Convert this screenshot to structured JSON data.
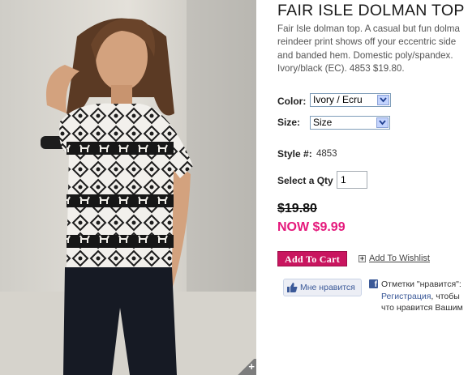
{
  "product": {
    "title": "FAIR ISLE DOLMAN TOP",
    "description": {
      "line1": "Fair Isle dolman top. A casual but fun dolma",
      "line2": "reindeer print shows off your eccentric side",
      "line3": "and banded hem. Domestic poly/spandex.",
      "line4": "Ivory/black (EC). 4853 $19.80."
    },
    "color_label": "Color:",
    "color_value": "Ivory / Ecru",
    "size_label": "Size:",
    "size_value": "Size",
    "style_label": "Style #:",
    "style_value": "4853",
    "qty_label": "Select a Qty",
    "qty_value": "1",
    "old_price": "$19.80",
    "now_price": "NOW $9.99",
    "add_to_cart": "Add To Cart",
    "add_to_wishlist": "Add To Wishlist",
    "wishlist_icon": "+"
  },
  "photo": {
    "zoom_glyph": "+",
    "icon": "zoom-plus-icon"
  },
  "facebook": {
    "like_button": "Мне нравится",
    "logo": "f",
    "text_line1": "Отметки \"нравится\":",
    "text_link": "Регистрация",
    "text_line2_rest": ", чтобы",
    "text_line3": "что нравится Вашим"
  },
  "colors": {
    "accent_pink": "#e5197c",
    "cart_button": "#c9155f",
    "facebook_blue": "#3b5998",
    "select_arrow": "#c3d3fd"
  }
}
